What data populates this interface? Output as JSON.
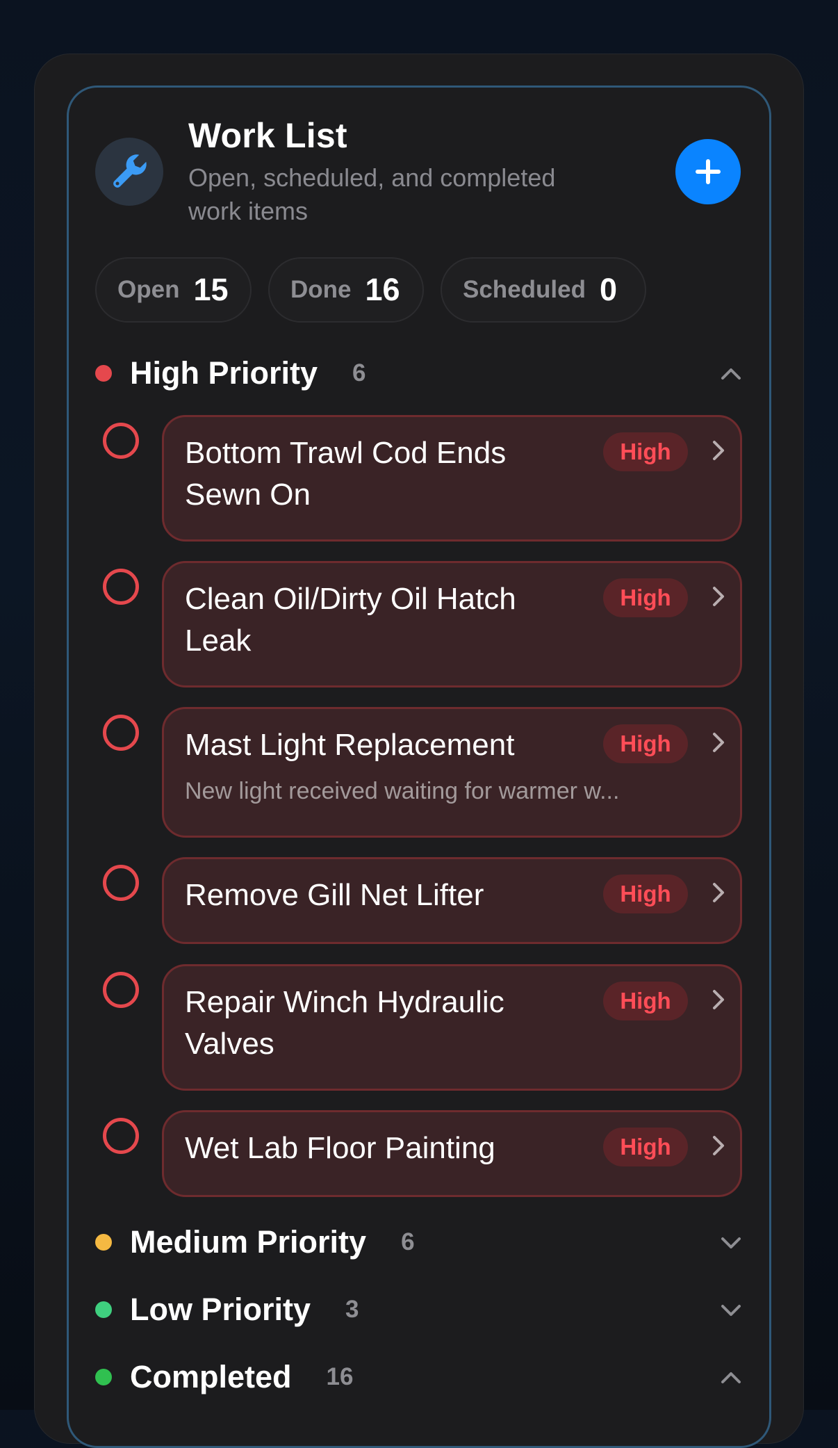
{
  "header": {
    "title": "Work List",
    "subtitle": "Open, scheduled, and completed work items",
    "icon": "wrench-icon",
    "add_icon": "plus-icon"
  },
  "stats": [
    {
      "label": "Open",
      "value": "15"
    },
    {
      "label": "Done",
      "value": "16"
    },
    {
      "label": "Scheduled",
      "value": "0"
    }
  ],
  "sections": {
    "high": {
      "title": "High Priority",
      "count": "6",
      "color": "#e5484d",
      "expanded": true
    },
    "medium": {
      "title": "Medium Priority",
      "count": "6",
      "color": "#f5b942",
      "expanded": false
    },
    "low": {
      "title": "Low Priority",
      "count": "3",
      "color": "#3fcf7f",
      "expanded": false
    },
    "completed": {
      "title": "Completed",
      "count": "16",
      "color": "#30c050",
      "expanded": true
    }
  },
  "tasks": [
    {
      "title": "Bottom Trawl Cod Ends Sewn On",
      "note": "",
      "badge": "High"
    },
    {
      "title": "Clean Oil/Dirty Oil Hatch Leak",
      "note": "",
      "badge": "High"
    },
    {
      "title": "Mast Light Replacement",
      "note": "New light received waiting for warmer w...",
      "badge": "High"
    },
    {
      "title": "Remove Gill Net Lifter",
      "note": "",
      "badge": "High"
    },
    {
      "title": "Repair Winch Hydraulic Valves",
      "note": "",
      "badge": "High"
    },
    {
      "title": "Wet Lab Floor Painting",
      "note": "",
      "badge": "High"
    }
  ]
}
